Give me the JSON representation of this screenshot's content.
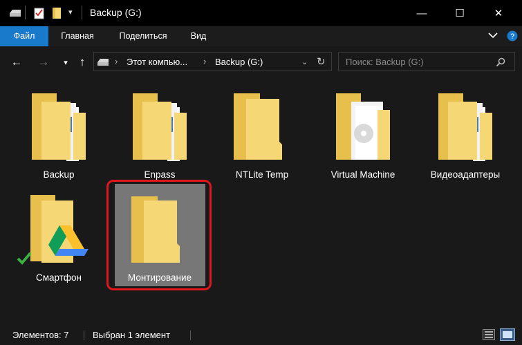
{
  "window": {
    "title": "Backup (G:)",
    "controls": {
      "minimize": "—",
      "maximize": "☐",
      "close": "✕"
    }
  },
  "ribbon": {
    "tabs": [
      "Файл",
      "Главная",
      "Поделиться",
      "Вид"
    ]
  },
  "address": {
    "crumbs": [
      "Этот компью...",
      "Backup (G:)"
    ],
    "search_placeholder": "Поиск: Backup (G:)"
  },
  "items": [
    {
      "label": "Backup",
      "type": "folder-docs"
    },
    {
      "label": "Enpass",
      "type": "folder-docs"
    },
    {
      "label": "NTLite Temp",
      "type": "folder-empty"
    },
    {
      "label": "Virtual Machine",
      "type": "folder-disc"
    },
    {
      "label": "Видеоадаптеры",
      "type": "folder-docs"
    },
    {
      "label": "Смартфон",
      "type": "folder-drive"
    },
    {
      "label": "Монтирование",
      "type": "folder-empty",
      "selected": true
    }
  ],
  "status": {
    "count": "Элементов: 7",
    "selection": "Выбран 1 элемент"
  },
  "colors": {
    "accent": "#1979ca",
    "selection_ring": "#e0161d",
    "selected_bg": "#777777",
    "folder": "#f6d776"
  }
}
